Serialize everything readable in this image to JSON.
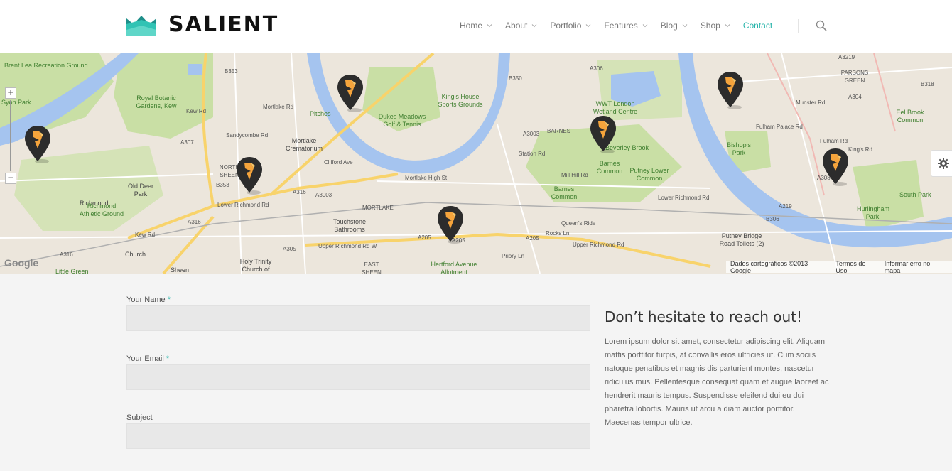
{
  "header": {
    "logo_text": "SALIENT",
    "nav": [
      {
        "label": "Home",
        "has_dropdown": true
      },
      {
        "label": "About",
        "has_dropdown": true
      },
      {
        "label": "Portfolio",
        "has_dropdown": true
      },
      {
        "label": "Features",
        "has_dropdown": true
      },
      {
        "label": "Blog",
        "has_dropdown": true
      },
      {
        "label": "Shop",
        "has_dropdown": true
      },
      {
        "label": "Contact",
        "has_dropdown": false,
        "active": true
      }
    ]
  },
  "map": {
    "labels": {
      "brent_lea": "Brent Lea Recreation Ground",
      "syon": "Syon Park",
      "royal_botanic": "Royal Botanic Gardens, Kew",
      "richmond": "Richmond",
      "pitches": "Pitches",
      "kings_house": "King's House Sports Grounds",
      "dukes_meadows": "Dukes Meadows Golf & Tennis",
      "wwt": "WWT London Wetland Centre",
      "mortlake_crem": "Mortlake Crematorium",
      "north_sheen": "NORTH SHEEN",
      "old_deer": "Old Deer Park",
      "richmond_athletic": "Richmond Athletic Ground",
      "barnes": "BARNES",
      "barnes_common": "Barnes Common",
      "barnes_common2": "Barnes Common",
      "putney_lower": "Putney Lower Common",
      "mortlake": "MORTLAKE",
      "touchstone": "Touchstone Bathrooms",
      "east_sheen": "EAST SHEEN",
      "hertford": "Hertford Avenue Allotment",
      "holy_trinity": "Holy Trinity Church of England",
      "little_green": "Little Green",
      "church": "Church",
      "bishops": "Bishop's Park",
      "eel_brook": "Eel Brook Common",
      "south_park": "South Park",
      "hurlingham": "Hurlingham Park",
      "putney_bridge": "Putney Bridge Road Toilets (2)",
      "parsons": "PARSONS GREEN",
      "beverley": "Beverley Brook",
      "sheen": "Sheen"
    },
    "roads": {
      "a205": "A205",
      "a305": "A305",
      "a316": "A316",
      "a3003": "A3003",
      "a307": "A307",
      "b353": "B353",
      "b350": "B350",
      "a306": "A306",
      "a219": "A219",
      "a308": "A308",
      "b306": "B306",
      "a304": "A304",
      "a3219": "A3219",
      "b318": "B318",
      "kew_rd": "Kew Rd",
      "lower_richmond": "Lower Richmond Rd",
      "lower_richmond2": "Lower Richmond Rd",
      "upper_richmond": "Upper Richmond Rd W",
      "upper_richmond2": "Upper Richmond Rd",
      "mortlake_high": "Mortlake High St",
      "mortlake_rd": "Mortlake Rd",
      "clifford": "Clifford Ave",
      "sandycombe": "Sandycombe Rd",
      "mill_hill": "Mill Hill Rd",
      "station": "Station Rd",
      "queens": "Queen's Ride",
      "rocks": "Rocks Ln",
      "priory": "Priory Ln",
      "fulham_palace": "Fulham Palace Rd",
      "fulham": "Fulham Rd",
      "munster": "Munster Rd",
      "kings_rd": "King's Rd"
    },
    "zoom_in": "+",
    "zoom_out": "−",
    "google_logo": "Google",
    "footer": {
      "data": "Dados cartográficos ©2013 Google",
      "terms": "Termos de Uso",
      "report": "Informar erro no mapa"
    },
    "colors": {
      "land": "#ece6dc",
      "park": "#c9dfa5",
      "water": "#a5c4ef",
      "major_road": "#f8d36b",
      "pin": "#2c2c2c",
      "pin_accent": "#f5a43c"
    }
  },
  "contact": {
    "fields": [
      {
        "label": "Your Name",
        "required": "*"
      },
      {
        "label": "Your Email",
        "required": "*"
      },
      {
        "label": "Subject",
        "required": ""
      }
    ],
    "heading": "Don’t hesitate to reach out!",
    "body": "Lorem ipsum dolor sit amet, consectetur adipiscing elit. Aliquam mattis porttitor turpis, at convallis eros ultricies ut. Cum sociis natoque penatibus et magnis dis parturient montes, nascetur ridiculus mus. Pellentesque consequat quam et augue laoreet ac hendrerit mauris tempus. Suspendisse eleifend dui eu dui pharetra lobortis. Mauris ut arcu a diam auctor porttitor. Maecenas tempor ultrice."
  },
  "accent_color": "#27b4aa"
}
